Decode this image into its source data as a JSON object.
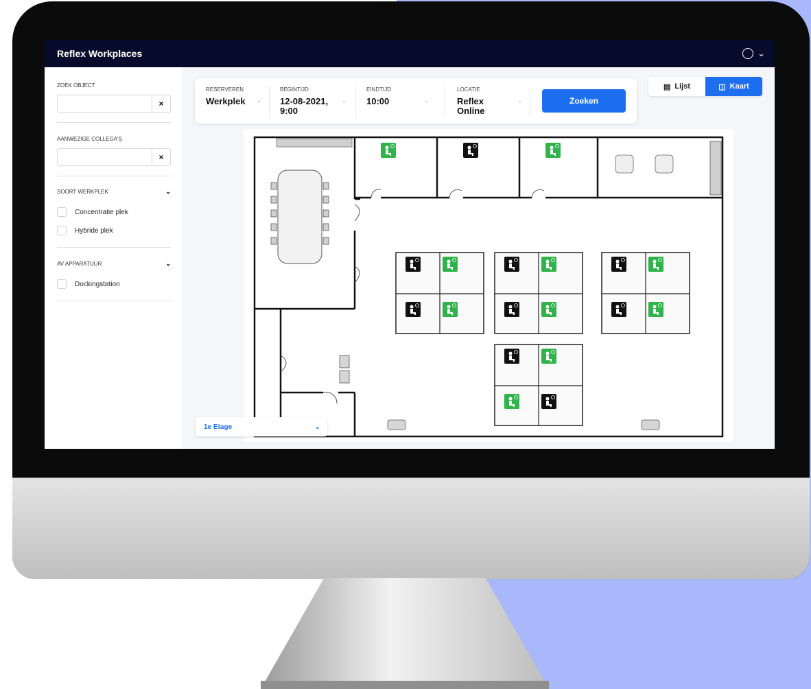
{
  "app": {
    "title": "Reflex Workplaces"
  },
  "sidebar": {
    "search_object": {
      "label": "ZOEK OBJECT",
      "value": "",
      "clear": "×"
    },
    "colleagues": {
      "label": "AANWEZIGE COLLEGA'S",
      "value": "",
      "clear": "×"
    },
    "workplace_type": {
      "label": "SOORT WERKPLEK",
      "options": [
        "Concentratie plek",
        "Hybride plek"
      ]
    },
    "av": {
      "label": "AV APPARATUUR",
      "options": [
        "Dockingstation"
      ]
    }
  },
  "search": {
    "reserve": {
      "label": "RESERVEREN",
      "value": "Werkplek"
    },
    "start": {
      "label": "BEGINTIJD",
      "value_line1": "12-08-2021,",
      "value_line2": "9:00"
    },
    "end": {
      "label": "EINDTIJD",
      "value": "10:00"
    },
    "location": {
      "label": "LOCATIE",
      "value_line1": "Reflex",
      "value_line2": "Online"
    },
    "button": "Zoeken"
  },
  "view_toggle": {
    "list": "Lijst",
    "map": "Kaart",
    "active": "map"
  },
  "floor": {
    "value": "1e Etage"
  },
  "colors": {
    "accent": "#1e6ff0",
    "topbar": "#070b2b",
    "available": "#2fb34a",
    "occupied": "#111111",
    "backdrop": "#a9b7fb"
  },
  "desks": [
    {
      "status": "available"
    },
    {
      "status": "occupied"
    },
    {
      "status": "available"
    },
    {
      "status": "occupied"
    },
    {
      "status": "available"
    },
    {
      "status": "occupied"
    },
    {
      "status": "available"
    },
    {
      "status": "occupied"
    },
    {
      "status": "available"
    },
    {
      "status": "occupied"
    },
    {
      "status": "available"
    },
    {
      "status": "occupied"
    },
    {
      "status": "available"
    },
    {
      "status": "occupied"
    },
    {
      "status": "available"
    },
    {
      "status": "occupied"
    },
    {
      "status": "available"
    },
    {
      "status": "available"
    },
    {
      "status": "occupied"
    }
  ]
}
